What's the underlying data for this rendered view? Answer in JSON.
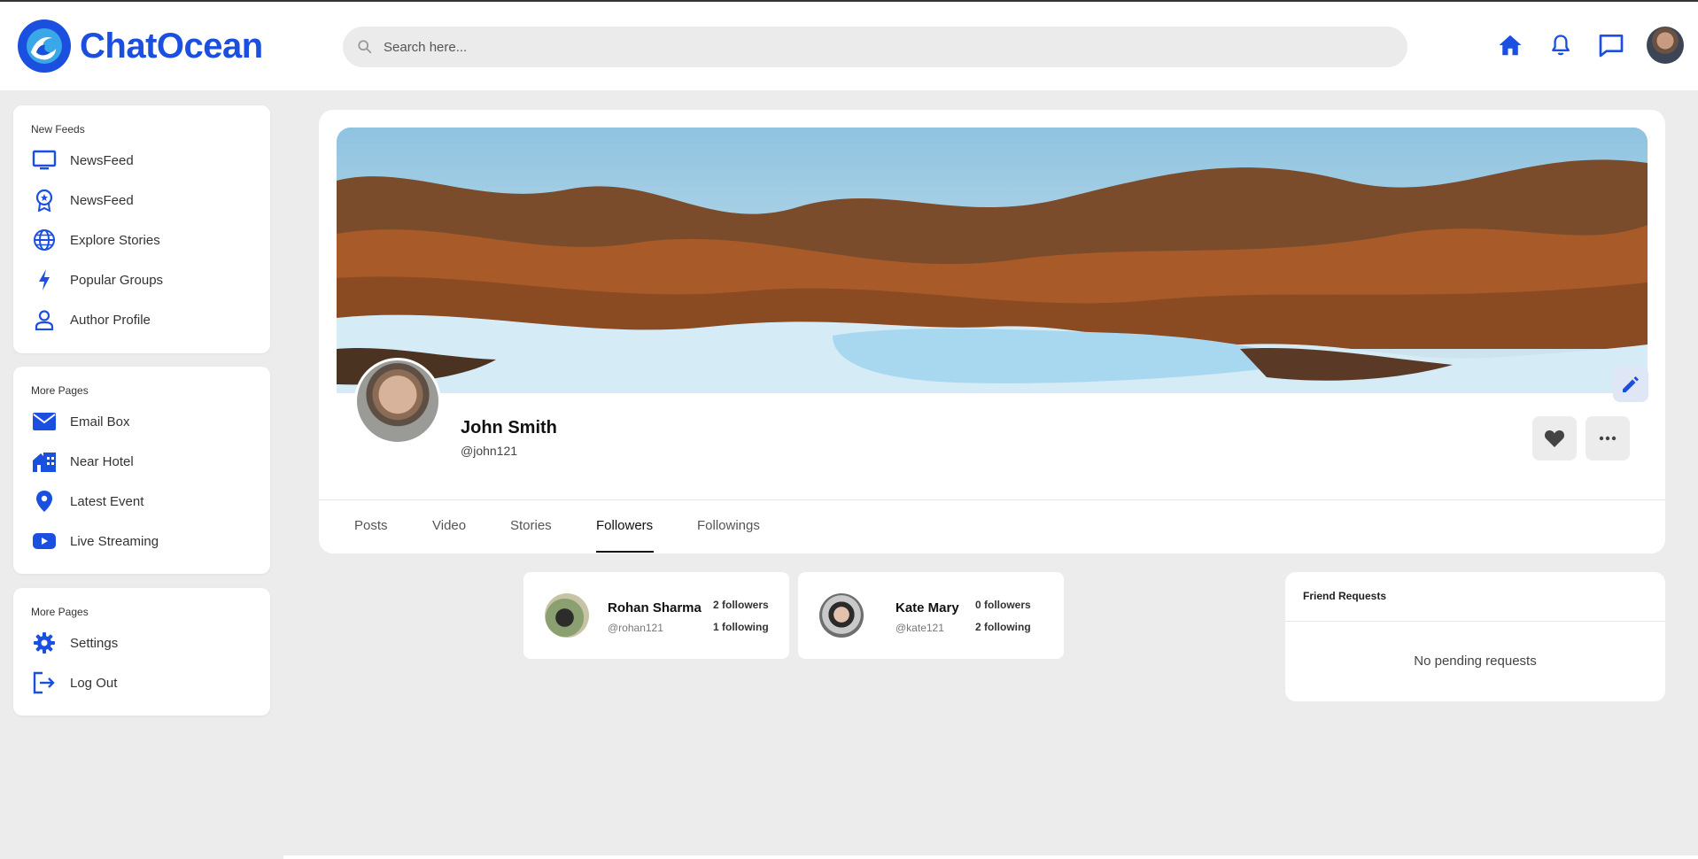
{
  "app": {
    "name": "ChatOcean"
  },
  "colors": {
    "accent": "#1a4fe0",
    "background": "#ececec",
    "card": "#ffffff"
  },
  "search": {
    "placeholder": "Search here..."
  },
  "header_icons": [
    "home-icon",
    "bell-icon",
    "chat-icon",
    "user-avatar"
  ],
  "sidebar": {
    "sections": [
      {
        "title": "New Feeds",
        "items": [
          {
            "label": "NewsFeed",
            "icon": "monitor-icon"
          },
          {
            "label": "NewsFeed",
            "icon": "badge-icon"
          },
          {
            "label": "Explore Stories",
            "icon": "globe-icon"
          },
          {
            "label": "Popular Groups",
            "icon": "lightning-icon"
          },
          {
            "label": "Author Profile",
            "icon": "user-icon"
          }
        ]
      },
      {
        "title": "More Pages",
        "items": [
          {
            "label": "Email Box",
            "icon": "mail-icon"
          },
          {
            "label": "Near Hotel",
            "icon": "hotel-icon"
          },
          {
            "label": "Latest Event",
            "icon": "location-pin-icon"
          },
          {
            "label": "Live Streaming",
            "icon": "youtube-icon"
          }
        ]
      },
      {
        "title": "More Pages",
        "items": [
          {
            "label": "Settings",
            "icon": "gear-icon"
          },
          {
            "label": "Log Out",
            "icon": "logout-icon"
          }
        ]
      }
    ]
  },
  "profile": {
    "name": "John Smith",
    "handle": "@john121",
    "tabs": [
      "Posts",
      "Video",
      "Stories",
      "Followers",
      "Followings"
    ],
    "active_tab": "Followers"
  },
  "followers": [
    {
      "name": "Rohan Sharma",
      "handle": "@rohan121",
      "followers": "2 followers",
      "following": "1 following"
    },
    {
      "name": "Kate Mary",
      "handle": "@kate121",
      "followers": "0 followers",
      "following": "2 following"
    }
  ],
  "friend_requests": {
    "title": "Friend Requests",
    "empty_text": "No pending requests"
  }
}
